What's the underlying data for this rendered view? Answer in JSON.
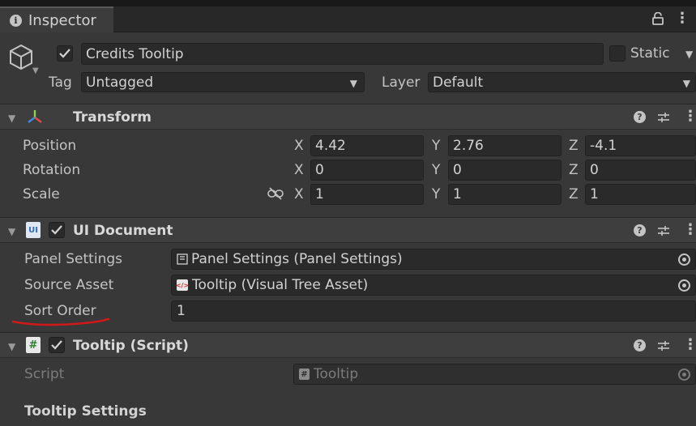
{
  "tab": {
    "title": "Inspector"
  },
  "object": {
    "name": "Credits Tooltip",
    "static_label": "Static",
    "tag_label": "Tag",
    "tag_value": "Untagged",
    "layer_label": "Layer",
    "layer_value": "Default"
  },
  "transform": {
    "title": "Transform",
    "rows": [
      {
        "label": "Position",
        "x": "4.42",
        "y": "2.76",
        "z": "-4.1"
      },
      {
        "label": "Rotation",
        "x": "0",
        "y": "0",
        "z": "0"
      },
      {
        "label": "Scale",
        "x": "1",
        "y": "1",
        "z": "1"
      }
    ],
    "axes": [
      "X",
      "Y",
      "Z"
    ]
  },
  "ui_document": {
    "title": "UI Document",
    "icon_text": "UI",
    "panel_settings_label": "Panel Settings",
    "panel_settings_value": "Panel Settings (Panel Settings)",
    "source_asset_label": "Source Asset",
    "source_asset_value": "Tooltip (Visual Tree Asset)",
    "sort_order_label": "Sort Order",
    "sort_order_value": "1"
  },
  "tooltip_script": {
    "title": "Tooltip (Script)",
    "script_label": "Script",
    "script_value": "Tooltip",
    "settings_header": "Tooltip Settings"
  },
  "colors": {
    "panel_bg": "#383838",
    "field_bg": "#2a2a2a",
    "header_bg": "#3e3e3e",
    "annotation_red": "#d01818"
  }
}
